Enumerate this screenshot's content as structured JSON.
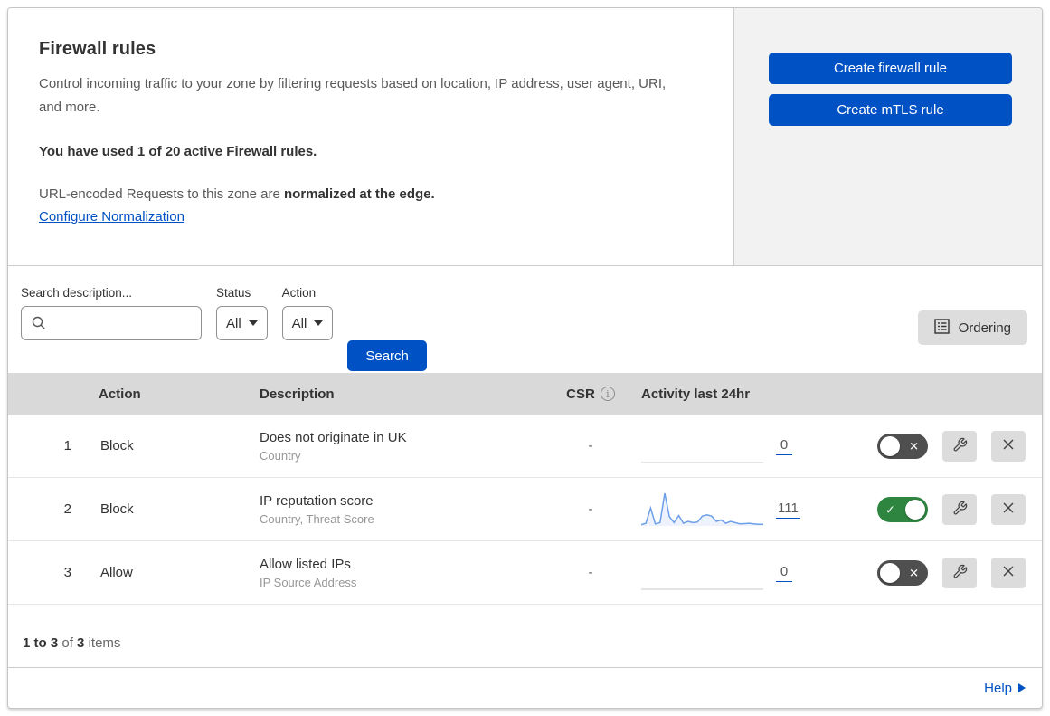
{
  "header": {
    "title": "Firewall rules",
    "description": "Control incoming traffic to your zone by filtering requests based on location, IP address, user agent, URI, and more.",
    "usage": "You have used 1 of 20 active Firewall rules.",
    "normalization_prefix": "URL-encoded Requests to this zone are ",
    "normalization_bold": "normalized at the edge.",
    "configure_link": "Configure Normalization",
    "create_firewall_button": "Create firewall rule",
    "create_mtls_button": "Create mTLS rule"
  },
  "filters": {
    "search_label": "Search description...",
    "search_value": "",
    "status_label": "Status",
    "status_value": "All",
    "action_label": "Action",
    "action_value": "All",
    "search_button": "Search",
    "ordering_button": "Ordering"
  },
  "table": {
    "columns": {
      "action": "Action",
      "description": "Description",
      "csr": "CSR",
      "activity": "Activity last 24hr"
    },
    "rows": [
      {
        "priority": "1",
        "action": "Block",
        "description": "Does not originate in UK",
        "fields": "Country",
        "csr": "-",
        "count": "0",
        "enabled": false
      },
      {
        "priority": "2",
        "action": "Block",
        "description": "IP reputation score",
        "fields": "Country, Threat Score",
        "csr": "-",
        "count": "111",
        "enabled": true,
        "sparkline": [
          4,
          8,
          55,
          6,
          10,
          100,
          28,
          10,
          32,
          8,
          14,
          10,
          12,
          30,
          34,
          30,
          14,
          18,
          8,
          14,
          10,
          6,
          7,
          8,
          6,
          5,
          5
        ]
      },
      {
        "priority": "3",
        "action": "Allow",
        "description": "Allow listed IPs",
        "fields": "IP Source Address",
        "csr": "-",
        "count": "0",
        "enabled": false
      }
    ]
  },
  "footer": {
    "range": "1 to 3",
    "of_label": "of",
    "total": "3",
    "items_label": "items"
  },
  "help": {
    "label": "Help"
  },
  "colors": {
    "accent_blue": "#0051c3",
    "toggle_on": "#2e8540",
    "toggle_off": "#4f4f4f",
    "sparkline_line": "#6d9fe8",
    "sparkline_fill": "#edf2fc",
    "header_bg": "#d9d9d9",
    "panel_bg": "#f2f2f2"
  }
}
